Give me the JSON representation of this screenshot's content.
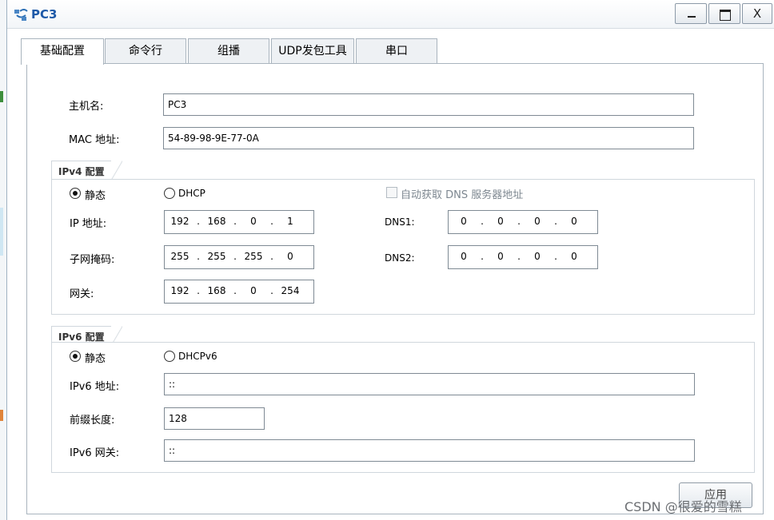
{
  "window": {
    "title": "PC3"
  },
  "tabs": [
    {
      "label": "基础配置",
      "active": true
    },
    {
      "label": "命令行",
      "active": false
    },
    {
      "label": "组播",
      "active": false
    },
    {
      "label": "UDP发包工具",
      "active": false
    },
    {
      "label": "串口",
      "active": false
    }
  ],
  "basic": {
    "hostname_label": "主机名:",
    "hostname_value": "PC3",
    "mac_label": "MAC 地址:",
    "mac_value": "54-89-98-9E-77-0A"
  },
  "ipv4": {
    "title": "IPv4 配置",
    "static_label": "静态",
    "dhcp_label": "DHCP",
    "mode": "static",
    "auto_dns_label": "自动获取 DNS 服务器地址",
    "auto_dns_checked": false,
    "ip_label": "IP 地址:",
    "ip": [
      "192",
      "168",
      "0",
      "1"
    ],
    "mask_label": "子网掩码:",
    "mask": [
      "255",
      "255",
      "255",
      "0"
    ],
    "gateway_label": "网关:",
    "gateway": [
      "192",
      "168",
      "0",
      "254"
    ],
    "dns1_label": "DNS1:",
    "dns1": [
      "0",
      "0",
      "0",
      "0"
    ],
    "dns2_label": "DNS2:",
    "dns2": [
      "0",
      "0",
      "0",
      "0"
    ]
  },
  "ipv6": {
    "title": "IPv6 配置",
    "static_label": "静态",
    "dhcp_label": "DHCPv6",
    "mode": "static",
    "addr_label": "IPv6 地址:",
    "addr_value": "::",
    "prefix_label": "前缀长度:",
    "prefix_value": "128",
    "gateway_label": "IPv6 网关:",
    "gateway_value": "::"
  },
  "apply_label": "应用",
  "watermark": "CSDN @很爱的雪糕",
  "colors": {
    "title_text": "#1f5aa8",
    "border": "#a9b4be",
    "group_border": "#d0d7dd"
  },
  "icons": {
    "app": "network-adapter-icon",
    "minimize": "minimize-icon",
    "maximize": "maximize-icon",
    "close": "close-icon"
  }
}
